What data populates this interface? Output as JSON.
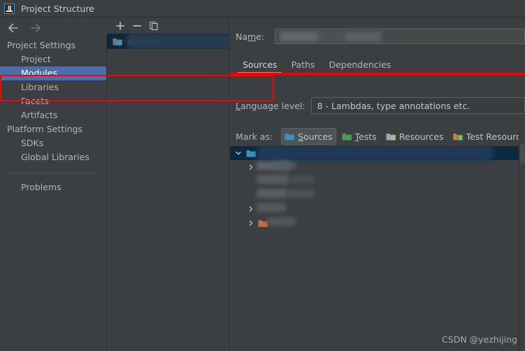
{
  "window": {
    "title": "Project Structure",
    "app_icon": "intellij-idea-icon"
  },
  "nav": {
    "back_icon": "arrow-left-icon",
    "forward_icon": "arrow-right-icon"
  },
  "sidebar": {
    "groups": [
      {
        "label": "Project Settings",
        "items": [
          {
            "label": "Project",
            "selected": false
          },
          {
            "label": "Modules",
            "selected": true
          },
          {
            "label": "Libraries",
            "selected": false
          },
          {
            "label": "Facets",
            "selected": false
          },
          {
            "label": "Artifacts",
            "selected": false
          }
        ]
      },
      {
        "label": "Platform Settings",
        "items": [
          {
            "label": "SDKs",
            "selected": false
          },
          {
            "label": "Global Libraries",
            "selected": false
          }
        ]
      }
    ],
    "footer_item": "Problems"
  },
  "module_list": {
    "toolbar": [
      {
        "name": "add-module-button",
        "icon": "plus-icon"
      },
      {
        "name": "remove-module-button",
        "icon": "minus-icon"
      },
      {
        "name": "copy-module-button",
        "icon": "copy-icon"
      }
    ],
    "selected_module": {
      "icon": "module-folder-icon",
      "visible_label": "ources",
      "redacted": true
    }
  },
  "details": {
    "name": {
      "label_prefix": "Na",
      "label_mnemonic": "m",
      "label_suffix": "e:",
      "value": "",
      "redacted": true
    },
    "tabs": [
      {
        "label": "Sources",
        "active": true
      },
      {
        "label": "Paths",
        "active": false
      },
      {
        "label": "Dependencies",
        "active": false
      }
    ],
    "language_level": {
      "label_mnemonic": "L",
      "label_rest": "anguage level:",
      "value": "8 - Lambdas, type annotations etc."
    },
    "mark_as": {
      "label": "Mark as:",
      "buttons": [
        {
          "name": "mark-sources-button",
          "label_mnemonic": "S",
          "label_rest": "ources",
          "icon": "folder-sources-icon",
          "pressed": true
        },
        {
          "name": "mark-tests-button",
          "label_mnemonic": "T",
          "label_rest": "ests",
          "icon": "folder-tests-icon",
          "pressed": false
        },
        {
          "name": "mark-resources-button",
          "label_mnemonic": "",
          "label_rest": "Resources",
          "icon": "folder-resources-icon",
          "pressed": false
        },
        {
          "name": "mark-test-resources-button",
          "label_mnemonic": "",
          "label_rest": "Test Resources",
          "icon": "folder-test-resources-icon",
          "pressed": false
        },
        {
          "name": "mark-excluded-button",
          "label_mnemonic": "",
          "label_rest": "",
          "icon": "folder-excluded-icon",
          "pressed": false
        }
      ]
    },
    "content_tree": {
      "rows": [
        {
          "indent": 0,
          "chevron": "expanded",
          "icon": "folder-blue-icon",
          "selected": true,
          "redacted": true
        },
        {
          "indent": 1,
          "chevron": "collapsed",
          "icon": "none",
          "selected": false,
          "redacted": true
        },
        {
          "indent": 1,
          "chevron": "none",
          "icon": "none",
          "selected": false,
          "redacted": true
        },
        {
          "indent": 1,
          "chevron": "none",
          "icon": "none",
          "selected": false,
          "redacted": true
        },
        {
          "indent": 1,
          "chevron": "collapsed",
          "icon": "none",
          "selected": false,
          "redacted": true
        },
        {
          "indent": 1,
          "chevron": "collapsed",
          "icon": "folder-orange-icon",
          "selected": false,
          "redacted": true
        }
      ]
    }
  },
  "annotation": {
    "highlight_color": "#fe0000",
    "target": "language-level-row"
  },
  "watermark": {
    "text": "CSDN @yezhijing"
  },
  "colors": {
    "background": "#3c3f41",
    "selection_blue": "#4b6eaf",
    "tree_selection": "#0d293e",
    "text": "#b4b4b4",
    "border": "#5e6264"
  }
}
